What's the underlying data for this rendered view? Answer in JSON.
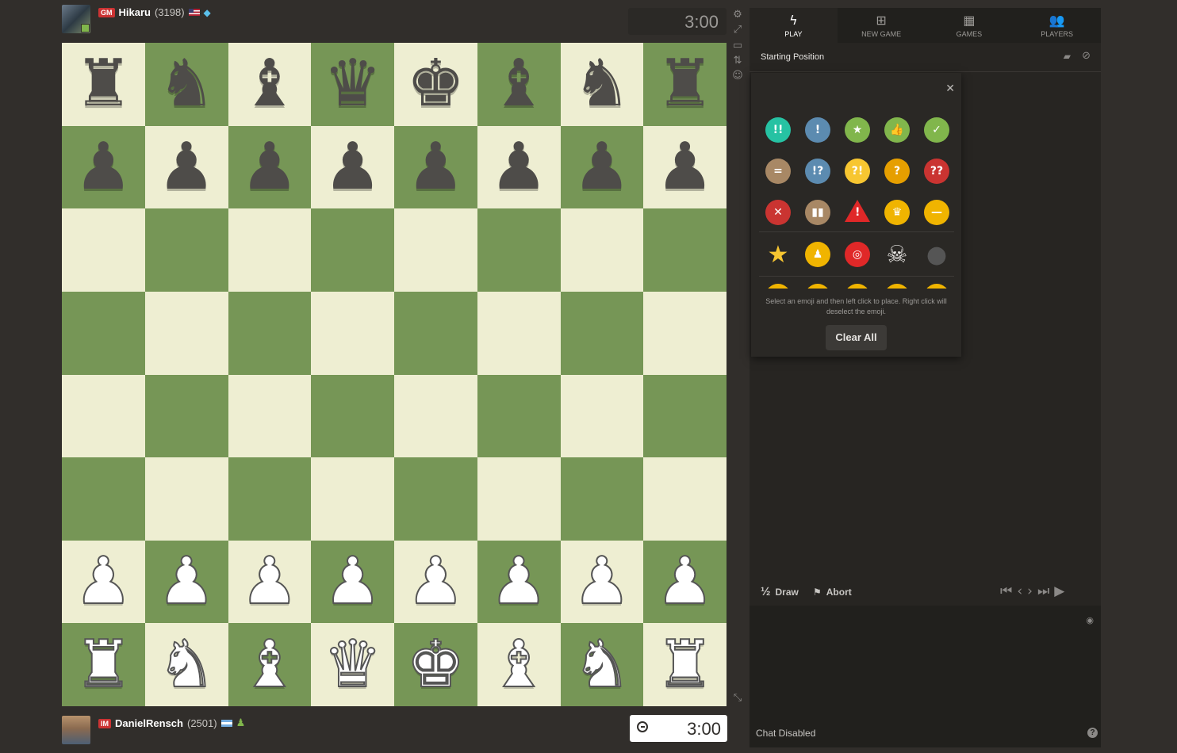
{
  "top_player": {
    "title": "GM",
    "name": "Hikaru",
    "rating": "(3198)",
    "flag": "us-flag",
    "badge_icon": "diamond-icon",
    "clock": "3:00"
  },
  "bottom_player": {
    "title": "IM",
    "name": "DanielRensch",
    "rating": "(2501)",
    "flag": "flag",
    "badge_icon": "pawn-icon",
    "clock": "3:00"
  },
  "board": {
    "light_color": "#eeeed2",
    "dark_color": "#769656",
    "position": [
      [
        "br",
        "bn",
        "bb",
        "bq",
        "bk",
        "bb",
        "bn",
        "br"
      ],
      [
        "bp",
        "bp",
        "bp",
        "bp",
        "bp",
        "bp",
        "bp",
        "bp"
      ],
      [
        "",
        "",
        "",
        "",
        "",
        "",
        "",
        ""
      ],
      [
        "",
        "",
        "",
        "",
        "",
        "",
        "",
        ""
      ],
      [
        "",
        "",
        "",
        "",
        "",
        "",
        "",
        ""
      ],
      [
        "",
        "",
        "",
        "",
        "",
        "",
        "",
        ""
      ],
      [
        "wp",
        "wp",
        "wp",
        "wp",
        "wp",
        "wp",
        "wp",
        "wp"
      ],
      [
        "wr",
        "wn",
        "wb",
        "wq",
        "wk",
        "wb",
        "wn",
        "wr"
      ]
    ]
  },
  "side_tools": [
    "settings-icon",
    "expand-icon",
    "theater-icon",
    "flip-board-icon",
    "emoji-icon"
  ],
  "tabs": [
    {
      "label": "PLAY",
      "icon": "lightning-icon",
      "active": true
    },
    {
      "label": "NEW GAME",
      "icon": "plus-icon",
      "active": false
    },
    {
      "label": "GAMES",
      "icon": "games-icon",
      "active": false
    },
    {
      "label": "PLAYERS",
      "icon": "players-icon",
      "active": false
    }
  ],
  "subheader": {
    "title": "Starting Position",
    "icons": [
      "book-icon",
      "compass-icon"
    ]
  },
  "emoji_popup": {
    "rows": [
      [
        {
          "name": "brilliant-icon",
          "glyph": "!!",
          "color": "#26c2a3"
        },
        {
          "name": "great-icon",
          "glyph": "!",
          "color": "#5c8bb0"
        },
        {
          "name": "best-icon",
          "glyph": "★",
          "color": "#81b64c"
        },
        {
          "name": "excellent-icon",
          "glyph": "👍",
          "color": "#81b64c"
        },
        {
          "name": "good-icon",
          "glyph": "✓",
          "color": "#81b64c"
        }
      ],
      [
        {
          "name": "equal-icon",
          "glyph": "=",
          "color": "#a88865"
        },
        {
          "name": "interesting-icon",
          "glyph": "!?",
          "color": "#5c8bb0"
        },
        {
          "name": "dubious-icon",
          "glyph": "?!",
          "color": "#f7c631"
        },
        {
          "name": "mistake-icon",
          "glyph": "?",
          "color": "#e69f00"
        },
        {
          "name": "blunder-icon",
          "glyph": "??",
          "color": "#ca3431"
        }
      ],
      [
        {
          "name": "wrong-icon",
          "glyph": "✕",
          "color": "#ca3431"
        },
        {
          "name": "book-move-icon",
          "glyph": "▮▮",
          "color": "#a88865"
        },
        {
          "name": "warning-icon",
          "glyph": "!",
          "color": "#e02828"
        },
        {
          "name": "crown-icon",
          "glyph": "♛",
          "color": "#f0b400"
        },
        {
          "name": "minus-icon",
          "glyph": "—",
          "color": "#f0b400"
        }
      ],
      [
        {
          "name": "star-icon",
          "glyph": "★",
          "color": "none"
        },
        {
          "name": "pawn-coin-icon",
          "glyph": "♟",
          "color": "#f0b400"
        },
        {
          "name": "target-icon",
          "glyph": "◎",
          "color": "#e02828"
        },
        {
          "name": "skull-icon",
          "glyph": "☠",
          "color": "none"
        },
        {
          "name": "bomb-icon",
          "glyph": "●",
          "color": "none"
        }
      ]
    ],
    "hint": "Select an emoji and then left click to place. Right click will deselect the emoji.",
    "clear_label": "Clear All"
  },
  "controls": {
    "draw_label": "Draw",
    "draw_prefix": "½",
    "abort_label": "Abort"
  },
  "nav_icons": [
    "first-move-icon",
    "previous-move-icon",
    "next-move-icon",
    "last-move-icon",
    "play-icon"
  ],
  "chat": {
    "status": "Chat Disabled"
  }
}
